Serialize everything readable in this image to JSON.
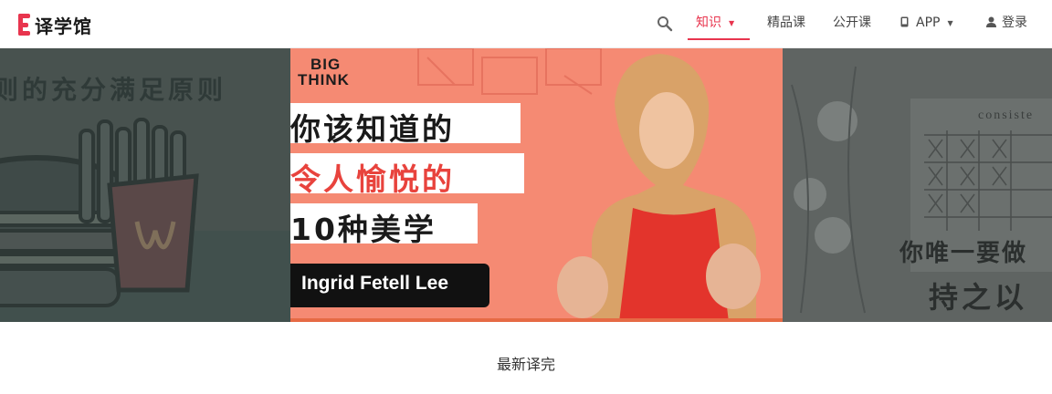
{
  "header": {
    "logo_text": "译学馆",
    "nav": [
      {
        "label": "知识",
        "active": true,
        "has_caret": true
      },
      {
        "label": "精品课"
      },
      {
        "label": "公开课"
      },
      {
        "label": "APP",
        "has_caret": true
      },
      {
        "label": "登录"
      }
    ],
    "caret": "▼",
    "accent_color": "#e8354e"
  },
  "banner": {
    "left_slide_text": "则的充分满足原则",
    "center_slide": {
      "brand_line1": "BIG",
      "brand_line2": "THINK",
      "title_line1": "你该知道的",
      "title_line2": "令人愉悦的",
      "title_line3": "10种美学",
      "speaker": "Ingrid Fetell Lee"
    },
    "right_slide_word": "consiste",
    "right_slide_text1": "你唯一要做",
    "right_slide_text2": "持之以"
  },
  "section": {
    "title": "最新译完"
  }
}
